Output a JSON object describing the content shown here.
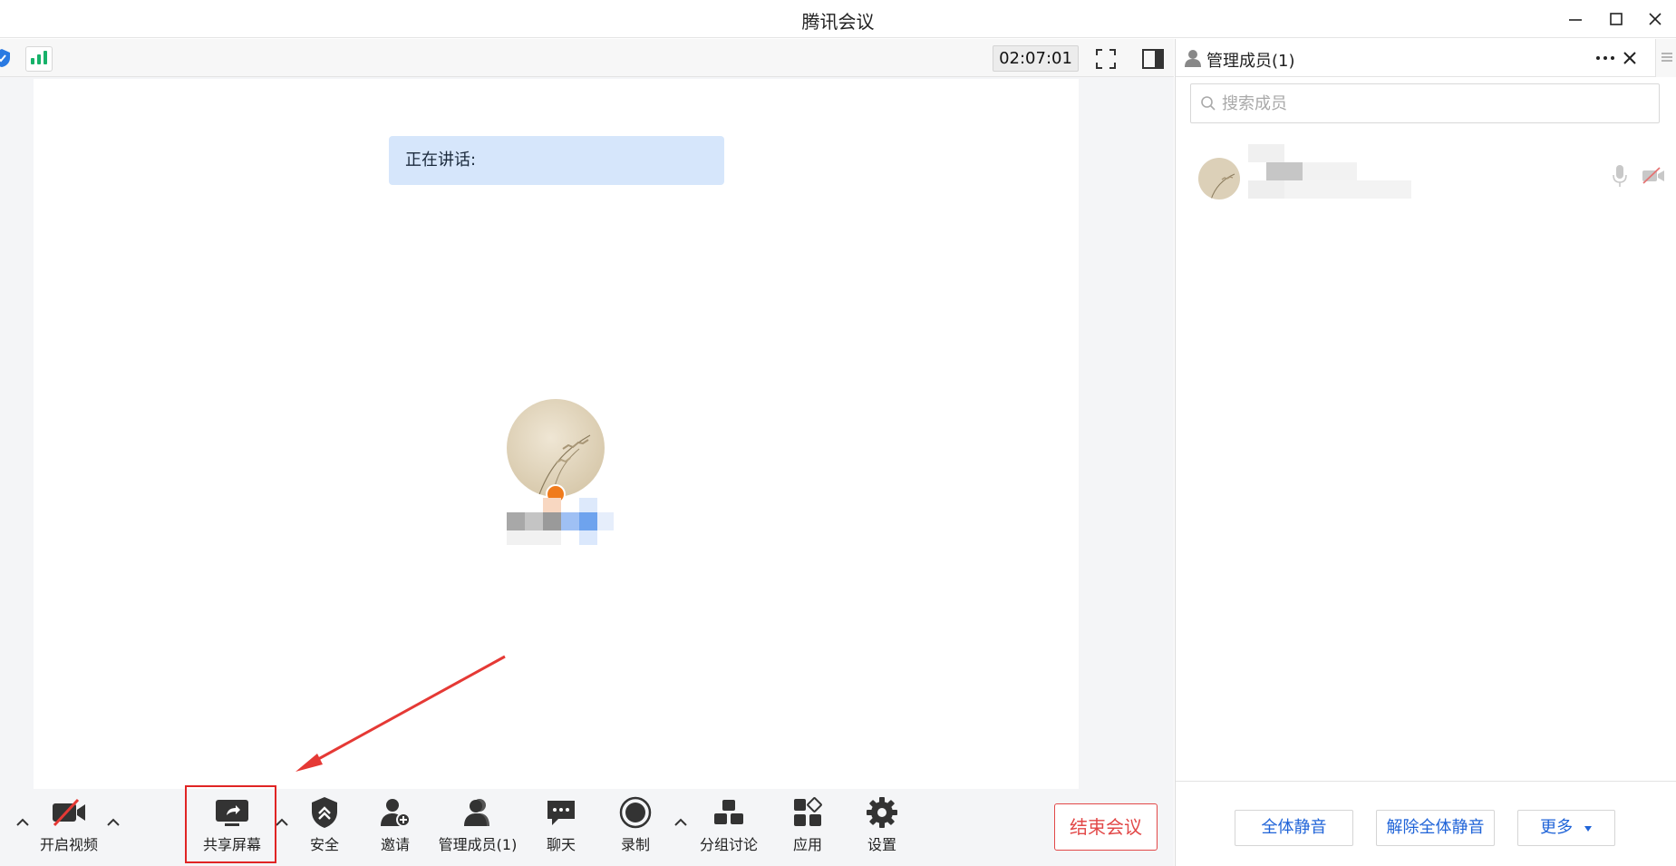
{
  "window": {
    "title": "腾讯会议"
  },
  "meeting": {
    "timer": "02:07:01",
    "speaking_label": "正在讲话:"
  },
  "toolbar": {
    "video_label": "开启视频",
    "share_label": "共享屏幕",
    "security_label": "安全",
    "invite_label": "邀请",
    "members_label": "管理成员(1)",
    "chat_label": "聊天",
    "record_label": "录制",
    "breakout_label": "分组讨论",
    "apps_label": "应用",
    "settings_label": "设置",
    "end_label": "结束会议"
  },
  "panel": {
    "title": "管理成员(1)",
    "search_placeholder": "搜索成员",
    "mute_all": "全体静音",
    "unmute_all": "解除全体静音",
    "more": "更多"
  },
  "colors": {
    "accent": "#2064d8",
    "danger": "#e24848",
    "signal": "#17b26a",
    "speaking_bg": "#d6e6fb"
  }
}
